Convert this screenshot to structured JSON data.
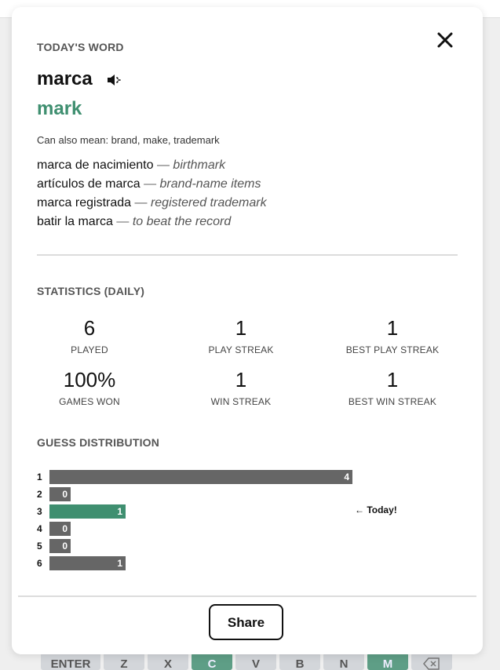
{
  "keyboard": {
    "keys": [
      {
        "label": "ENTER",
        "status": "default"
      },
      {
        "label": "Z",
        "status": "default"
      },
      {
        "label": "X",
        "status": "default"
      },
      {
        "label": "C",
        "status": "correct"
      },
      {
        "label": "V",
        "status": "default"
      },
      {
        "label": "B",
        "status": "default"
      },
      {
        "label": "N",
        "status": "default"
      },
      {
        "label": "M",
        "status": "correct"
      },
      {
        "label": "",
        "icon": "backspace-icon",
        "status": "default"
      }
    ]
  },
  "modal": {
    "close_icon": "close-icon",
    "word_section": {
      "label": "TODAY'S WORD",
      "word": "marca",
      "speaker_icon": "speaker-icon",
      "translation": "mark",
      "also_mean": "Can also mean: brand, make, trademark",
      "examples": [
        {
          "phrase": "marca de nacimiento",
          "separator": "—",
          "translation": "birthmark"
        },
        {
          "phrase": "artículos de marca",
          "separator": "—",
          "translation": "brand-name items"
        },
        {
          "phrase": "marca registrada",
          "separator": "—",
          "translation": "registered trademark"
        },
        {
          "phrase": "batir la marca",
          "separator": "—",
          "translation": "to beat the record"
        }
      ]
    },
    "statistics": {
      "label": "STATISTICS (DAILY)",
      "items": [
        {
          "value": "6",
          "label": "PLAYED"
        },
        {
          "value": "1",
          "label": "PLAY STREAK"
        },
        {
          "value": "1",
          "label": "BEST PLAY STREAK"
        },
        {
          "value": "100%",
          "label": "GAMES WON"
        },
        {
          "value": "1",
          "label": "WIN STREAK"
        },
        {
          "value": "1",
          "label": "BEST WIN STREAK"
        }
      ]
    },
    "distribution": {
      "label": "GUESS DISTRIBUTION",
      "rows": [
        {
          "guess": "1",
          "count": 4,
          "today": false
        },
        {
          "guess": "2",
          "count": 0,
          "today": false
        },
        {
          "guess": "3",
          "count": 1,
          "today": true
        },
        {
          "guess": "4",
          "count": 0,
          "today": false
        },
        {
          "guess": "5",
          "count": 0,
          "today": false
        },
        {
          "guess": "6",
          "count": 1,
          "today": false
        }
      ],
      "today_note": "← Today!"
    },
    "share_label": "Share"
  },
  "colors": {
    "accent": "#3f8f70",
    "bar": "#666666",
    "key_correct": "#5e9e86"
  }
}
